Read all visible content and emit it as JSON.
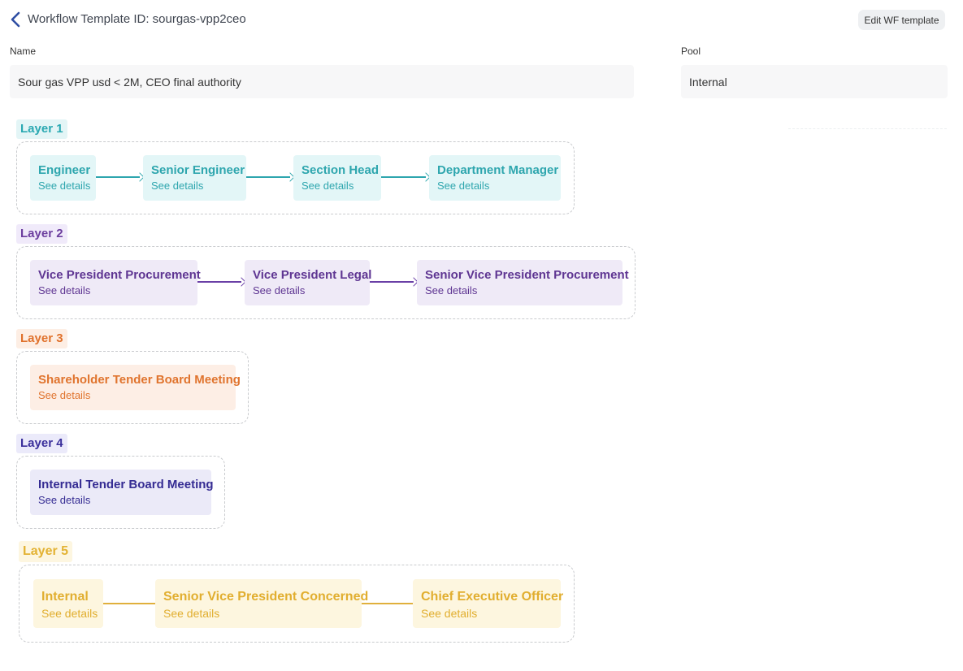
{
  "header": {
    "title": "Workflow Template ID: sourgas-vpp2ceo",
    "edit_label": "Edit WF template"
  },
  "form": {
    "name_label": "Name",
    "name_value": "Sour gas VPP usd < 2M, CEO final authority",
    "pool_label": "Pool",
    "pool_value": "Internal"
  },
  "layers": [
    {
      "label": "Layer 1",
      "nodes": [
        {
          "title": "Engineer",
          "sub": "See details"
        },
        {
          "title": "Senior Engineer",
          "sub": "See details"
        },
        {
          "title": "Section Head",
          "sub": "See details"
        },
        {
          "title": "Department Manager",
          "sub": "See details"
        }
      ]
    },
    {
      "label": "Layer 2",
      "nodes": [
        {
          "title": "Vice President Procurement",
          "sub": "See details"
        },
        {
          "title": "Vice President Legal",
          "sub": "See details"
        },
        {
          "title": "Senior Vice President Procurement",
          "sub": "See details"
        }
      ]
    },
    {
      "label": "Layer 3",
      "nodes": [
        {
          "title": "Shareholder Tender Board Meeting",
          "sub": "See details"
        }
      ]
    },
    {
      "label": "Layer 4",
      "nodes": [
        {
          "title": "Internal Tender Board Meeting",
          "sub": "See details"
        }
      ]
    },
    {
      "label": "Layer 5",
      "nodes": [
        {
          "title": "Internal",
          "sub": "See details"
        },
        {
          "title": "Senior Vice President Concerned",
          "sub": "See details"
        },
        {
          "title": "Chief Executive Officer",
          "sub": "See details"
        }
      ]
    }
  ],
  "colors": {
    "layer1": "#2ea6ae",
    "layer2": "#5e3592",
    "layer3": "#e0742e",
    "layer4": "#352c93",
    "layer5": "#e1ae2f"
  }
}
